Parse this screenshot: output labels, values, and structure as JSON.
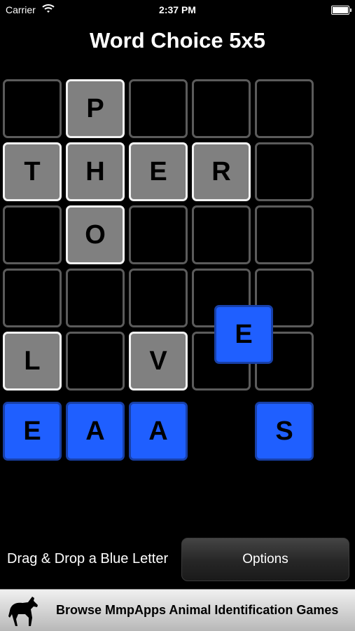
{
  "status_bar": {
    "carrier": "Carrier",
    "time": "2:37 PM",
    "icons": [
      "wifi-icon",
      "battery-icon"
    ]
  },
  "title": "Word Choice 5x5",
  "board": {
    "rows": [
      [
        {
          "letter": "",
          "state": "empty"
        },
        {
          "letter": "P",
          "state": "filled"
        },
        {
          "letter": "",
          "state": "empty"
        },
        {
          "letter": "",
          "state": "empty"
        },
        {
          "letter": "",
          "state": "empty"
        }
      ],
      [
        {
          "letter": "T",
          "state": "filled"
        },
        {
          "letter": "H",
          "state": "filled"
        },
        {
          "letter": "E",
          "state": "filled"
        },
        {
          "letter": "R",
          "state": "filled"
        },
        {
          "letter": "",
          "state": "empty"
        }
      ],
      [
        {
          "letter": "",
          "state": "empty"
        },
        {
          "letter": "O",
          "state": "filled"
        },
        {
          "letter": "",
          "state": "empty"
        },
        {
          "letter": "",
          "state": "empty"
        },
        {
          "letter": "",
          "state": "empty"
        }
      ],
      [
        {
          "letter": "",
          "state": "empty"
        },
        {
          "letter": "",
          "state": "empty"
        },
        {
          "letter": "",
          "state": "empty"
        },
        {
          "letter": "",
          "state": "empty"
        },
        {
          "letter": "",
          "state": "empty"
        }
      ],
      [
        {
          "letter": "L",
          "state": "filled"
        },
        {
          "letter": "",
          "state": "empty"
        },
        {
          "letter": "V",
          "state": "filled"
        },
        {
          "letter": "",
          "state": "empty"
        },
        {
          "letter": "",
          "state": "empty"
        }
      ]
    ],
    "dragging_tile": {
      "letter": "E"
    }
  },
  "tray": [
    {
      "letter": "E",
      "slot": 0
    },
    {
      "letter": "A",
      "slot": 1
    },
    {
      "letter": "A",
      "slot": 2
    },
    {
      "letter": "S",
      "slot": 4
    }
  ],
  "instruction": "Drag & Drop a Blue Letter",
  "options_label": "Options",
  "ad": {
    "text": "Browse MmpApps Animal Identification Games",
    "icon": "horse-icon"
  },
  "colors": {
    "tile_blue": "#1f5fff",
    "filled_gray": "#808080",
    "empty_border": "#5b5b5b"
  }
}
